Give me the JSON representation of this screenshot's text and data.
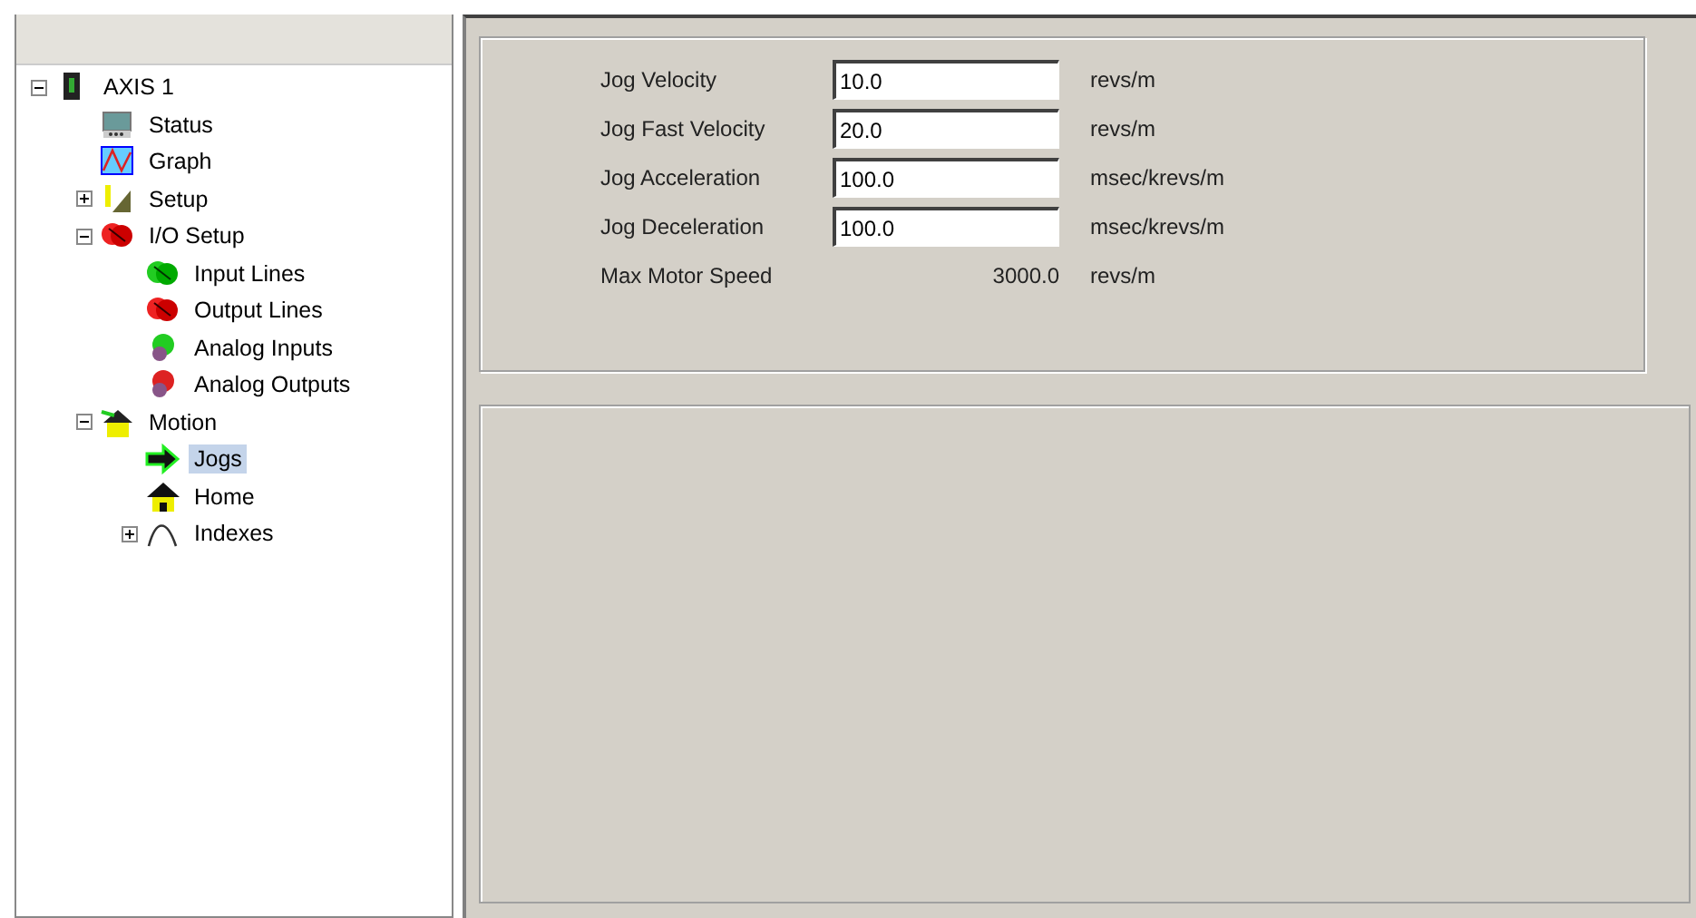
{
  "tree": [
    {
      "label": "AXIS 1",
      "kind": "drive",
      "expanded": true,
      "selected": false,
      "children": [
        {
          "label": "Status",
          "kind": "monitor",
          "selected": false
        },
        {
          "label": "Graph",
          "kind": "graph",
          "selected": false
        },
        {
          "label": "Setup",
          "kind": "setup",
          "expanded": false,
          "selected": false
        },
        {
          "label": "I/O Setup",
          "kind": "io-red",
          "expanded": true,
          "selected": false,
          "children": [
            {
              "label": "Input Lines",
              "kind": "io-green",
              "selected": false
            },
            {
              "label": "Output Lines",
              "kind": "io-red",
              "selected": false
            },
            {
              "label": "Analog Inputs",
              "kind": "analog-green",
              "selected": false
            },
            {
              "label": "Analog Outputs",
              "kind": "analog-red",
              "selected": false
            }
          ]
        },
        {
          "label": "Motion",
          "kind": "motion",
          "expanded": true,
          "selected": false,
          "children": [
            {
              "label": "Jogs",
              "kind": "arrow",
              "selected": true
            },
            {
              "label": "Home",
              "kind": "house",
              "selected": false
            },
            {
              "label": "Indexes",
              "kind": "curve",
              "expanded": false,
              "selected": false
            }
          ]
        }
      ]
    }
  ],
  "form": [
    {
      "label": "Jog Velocity",
      "kind": "input",
      "value": "10.0",
      "unit": "revs/m"
    },
    {
      "label": "Jog Fast Velocity",
      "kind": "input",
      "value": "20.0",
      "unit": "revs/m"
    },
    {
      "label": "Jog Acceleration",
      "kind": "input",
      "value": "100.0",
      "unit": "msec/krevs/m"
    },
    {
      "label": "Jog Deceleration",
      "kind": "input",
      "value": "100.0",
      "unit": "msec/krevs/m"
    },
    {
      "label": "Max Motor Speed",
      "kind": "readout",
      "value": "3000.0",
      "unit": "revs/m"
    }
  ]
}
